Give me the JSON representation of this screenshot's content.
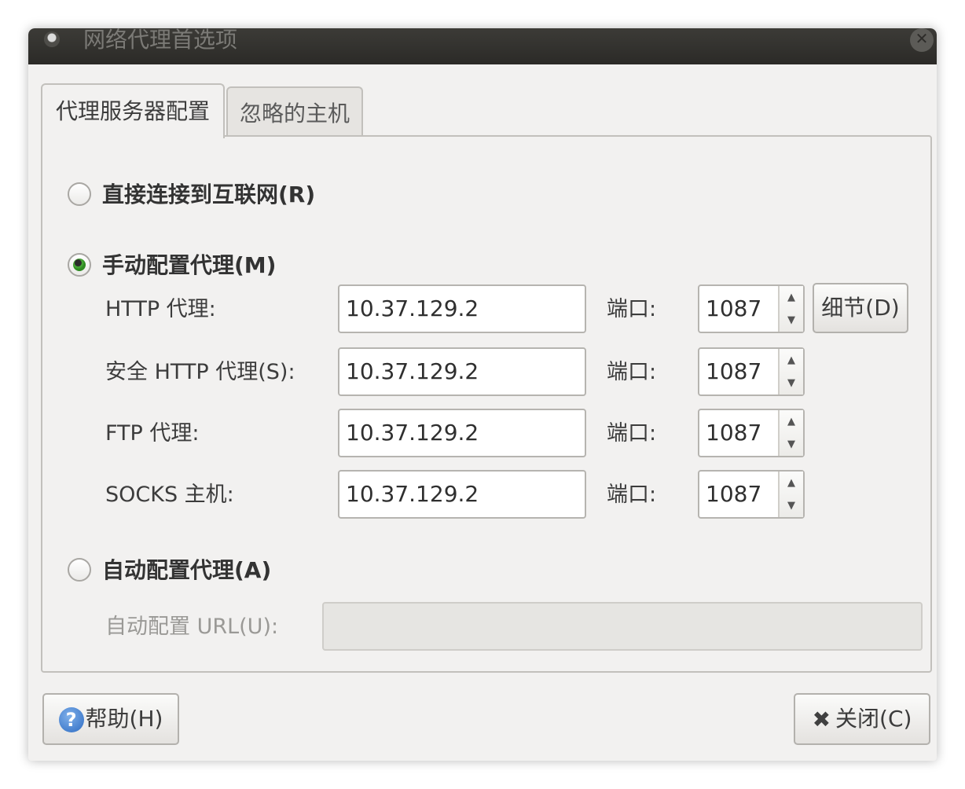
{
  "window": {
    "title": "网络代理首选项"
  },
  "tabs": [
    {
      "label": "代理服务器配置",
      "active": true
    },
    {
      "label": "忽略的主机",
      "active": false
    }
  ],
  "options": {
    "direct": {
      "label": "直接连接到互联网(R)",
      "checked": false
    },
    "manual": {
      "label": "手动配置代理(M)",
      "checked": true
    },
    "auto": {
      "label": "自动配置代理(A)",
      "checked": false
    }
  },
  "manual_rows": [
    {
      "label": "HTTP 代理:",
      "host": "10.37.129.2",
      "port_label": "端口:",
      "port": "1087"
    },
    {
      "label": "安全 HTTP 代理(S):",
      "host": "10.37.129.2",
      "port_label": "端口:",
      "port": "1087"
    },
    {
      "label": "FTP 代理:",
      "host": "10.37.129.2",
      "port_label": "端口:",
      "port": "1087"
    },
    {
      "label": "SOCKS 主机:",
      "host": "10.37.129.2",
      "port_label": "端口:",
      "port": "1087"
    }
  ],
  "details_button": "细节(D)",
  "auto_url": {
    "label": "自动配置 URL(U):",
    "value": ""
  },
  "footer": {
    "help_label": "帮助(H)",
    "close_label": "关闭(C)"
  },
  "icons": {
    "help": "question-circle",
    "close": "x-mark",
    "spin_up": "▲",
    "spin_down": "▼"
  }
}
